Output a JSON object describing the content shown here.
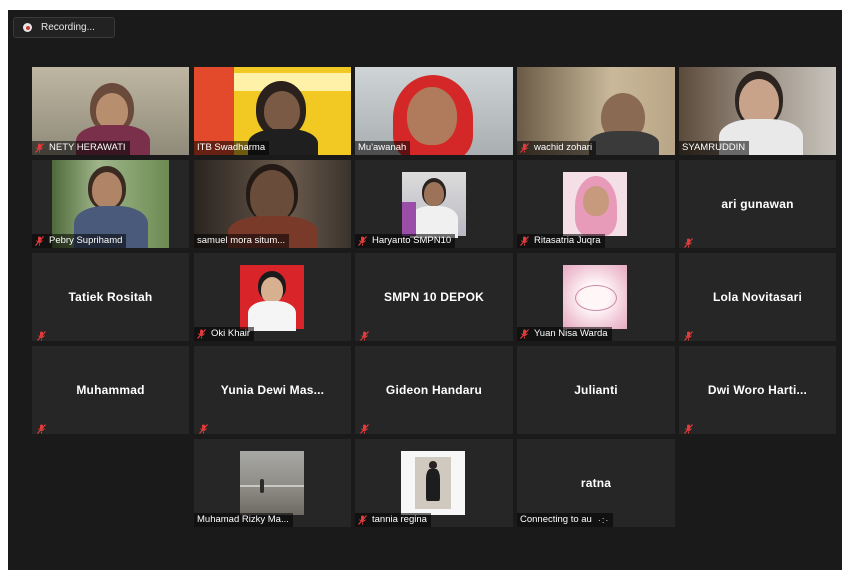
{
  "recording": {
    "label": "Recording..."
  },
  "colors": {
    "muted_mic": "#e03c3c",
    "active_speaker_border": "#c7e08a",
    "tile_bg": "#262626"
  },
  "participants": {
    "p1": {
      "name": "NETY HERAWATI"
    },
    "p2": {
      "name": "ITB Swadharma"
    },
    "p3": {
      "name": "Mu'awanah"
    },
    "p4": {
      "name": "wachid zohari"
    },
    "p5": {
      "name": "SYAMRUDDIN"
    },
    "p6": {
      "name": "Pebry Suprihamd"
    },
    "p7": {
      "name": "samuel mora situm..."
    },
    "p8": {
      "name": "Haryanto SMPN10"
    },
    "p9": {
      "name": "Ritasatria Juqra"
    },
    "p10": {
      "name": "ari gunawan"
    },
    "p11": {
      "name": "Tatiek Rositah"
    },
    "p12": {
      "name": "Oki Khair"
    },
    "p13": {
      "name": "SMPN 10 DEPOK"
    },
    "p14": {
      "name": "Yuan Nisa Warda"
    },
    "p15": {
      "name": "Lola Novitasari"
    },
    "p16": {
      "name": "Muhammad"
    },
    "p17": {
      "name": "Yunia Dewi Mas..."
    },
    "p18": {
      "name": "Gideon Handaru"
    },
    "p19": {
      "name": "Julianti"
    },
    "p20": {
      "name": "Dwi Woro Harti..."
    },
    "p21": {
      "name": "Muhamad Rizky Ma..."
    },
    "p22": {
      "name": "tannia regina"
    },
    "p23": {
      "name": "ratna",
      "status": "Connecting to au"
    }
  }
}
